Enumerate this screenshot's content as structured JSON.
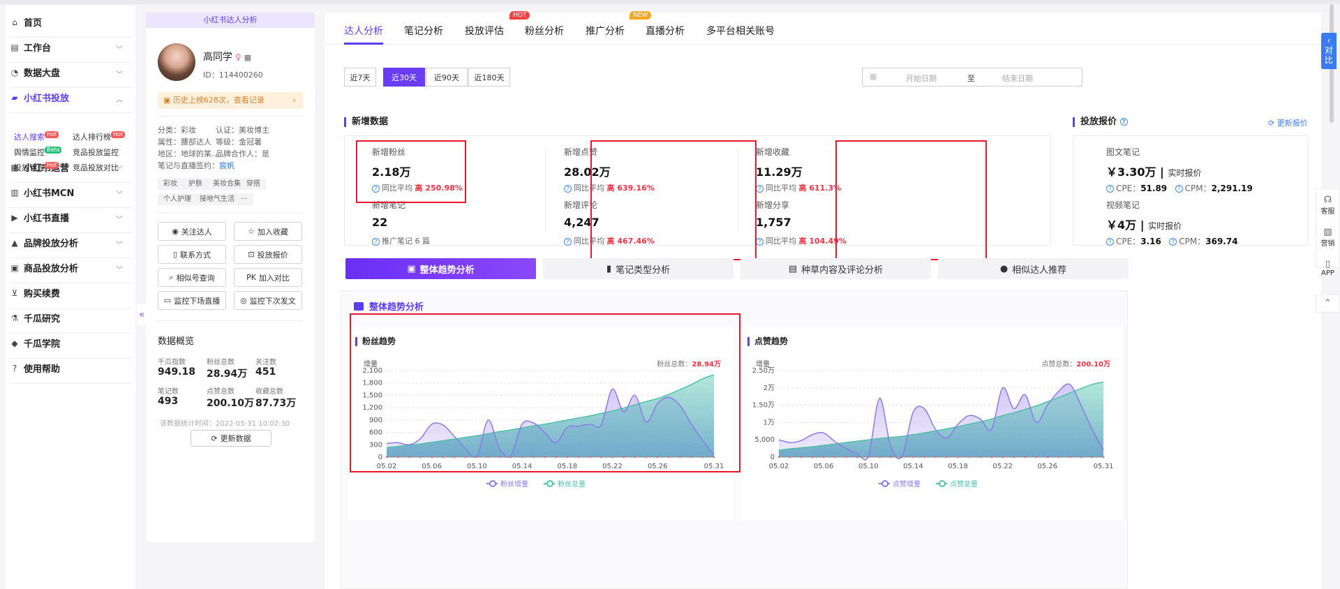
{
  "sidebar": {
    "items": [
      {
        "icon": "home-icon",
        "label": "首页",
        "chevron": false
      },
      {
        "icon": "workbench-icon",
        "label": "工作台",
        "chevron": true
      },
      {
        "icon": "dashboard-icon",
        "label": "数据大盘",
        "chevron": true
      },
      {
        "icon": "folder-icon",
        "label": "小红书投放",
        "chevron": true,
        "active": true
      },
      {
        "icon": "chart-icon",
        "label": "小红书运营",
        "chevron": true
      },
      {
        "icon": "mcn-icon",
        "label": "小红书MCN",
        "chevron": true
      },
      {
        "icon": "live-icon",
        "label": "小红书直播",
        "chevron": true
      },
      {
        "icon": "brand-icon",
        "label": "品牌投放分析",
        "chevron": true
      },
      {
        "icon": "shop-icon",
        "label": "商品投放分析",
        "chevron": true
      },
      {
        "icon": "cart-icon",
        "label": "购买续费",
        "chevron": false
      },
      {
        "icon": "flask-icon",
        "label": "千瓜研究",
        "chevron": false
      },
      {
        "icon": "graduation-icon",
        "label": "千瓜学院",
        "chevron": false
      },
      {
        "icon": "help-icon",
        "label": "使用帮助",
        "chevron": false
      }
    ],
    "subs": [
      {
        "label": "达人搜索",
        "tag": "Hot"
      },
      {
        "label": "达人排行榜",
        "tag": "Hot"
      },
      {
        "label": "舆情监控",
        "tag": "Beta"
      },
      {
        "label": "竞品投放监控",
        "tag": ""
      },
      {
        "label": "投放管理",
        "tag": "Hot"
      },
      {
        "label": "竞品投放对比",
        "tag": ""
      }
    ],
    "collapse": "«"
  },
  "profile": {
    "title": "小红书达人分析",
    "name": "高同学",
    "gender": "♀",
    "qr": "▦",
    "id": "ID：114400260",
    "history": "历史上榜628次，查看记录",
    "info": {
      "category": "分类：彩妆",
      "cert": "认证：美妆博主",
      "attr": "属性：腰部达人",
      "level": "等级：金冠薯",
      "region": "地区：地球的某...",
      "brand_partner": "品牌合作人：是",
      "sign_label": "笔记与直播签约：",
      "sign_value": "宸帆"
    },
    "chips": [
      "彩妆",
      "护肤",
      "美妆合集",
      "穿搭",
      "个人护理",
      "接地气生活",
      "···"
    ],
    "buttons": [
      {
        "icon": "eye-icon",
        "label": "关注达人"
      },
      {
        "icon": "star-icon",
        "label": "加入收藏"
      },
      {
        "icon": "phone-icon",
        "label": "联系方式"
      },
      {
        "icon": "price-icon",
        "label": "投放报价"
      },
      {
        "icon": "search-icon",
        "label": "相似号查询"
      },
      {
        "icon": "pk-icon",
        "label": "加入对比"
      },
      {
        "icon": "video-icon",
        "label": "监控下场直播"
      },
      {
        "icon": "pin-icon",
        "label": "监控下次发文"
      }
    ],
    "overview_title": "数据概览",
    "stats": [
      {
        "label": "千瓜指数",
        "value": "949.18"
      },
      {
        "label": "粉丝总数",
        "value": "28.94万"
      },
      {
        "label": "关注数",
        "value": "451"
      },
      {
        "label": "笔记数",
        "value": "493"
      },
      {
        "label": "点赞总数",
        "value": "200.10万"
      },
      {
        "label": "收藏总数",
        "value": "87.73万"
      }
    ],
    "stat_time": "该数据统计时间：2022-05-31 10:02:30",
    "refresh": "更新数据"
  },
  "tabs": [
    {
      "label": "达人分析",
      "badge": ""
    },
    {
      "label": "笔记分析",
      "badge": ""
    },
    {
      "label": "投放评估",
      "badge": ""
    },
    {
      "label": "粉丝分析",
      "badge": "HOT"
    },
    {
      "label": "推广分析",
      "badge": ""
    },
    {
      "label": "直播分析",
      "badge": "NEW"
    },
    {
      "label": "多平台相关账号",
      "badge": ""
    }
  ],
  "ranges": [
    "近7天",
    "近30天",
    "近90天",
    "近180天"
  ],
  "date": {
    "start": "开始日期",
    "sep": "至",
    "end": "结束日期"
  },
  "new_data": {
    "title": "新增数据",
    "metrics": [
      {
        "label": "新增粉丝",
        "value": "2.18万",
        "sub": "同比平均",
        "high": "高 250.98%"
      },
      {
        "label": "新增笔记",
        "value": "22",
        "sub": "推广笔记 6 篇",
        "high": ""
      },
      {
        "label": "新增点赞",
        "value": "28.02万",
        "sub": "同比平均",
        "high": "高 639.16%"
      },
      {
        "label": "新增评论",
        "value": "4,247",
        "sub": "同比平均",
        "high": "高 467.46%"
      },
      {
        "label": "新增收藏",
        "value": "11.29万",
        "sub": "同比平均",
        "high": "高 611.3%"
      },
      {
        "label": "新增分享",
        "value": "1,757",
        "sub": "同比平均",
        "high": "高 104.49%"
      }
    ]
  },
  "price": {
    "title": "投放报价",
    "update": "更新报价",
    "items": [
      {
        "label": "图文笔记",
        "value": "￥3.30万",
        "rt": "实时报价",
        "cpe_label": "CPE：",
        "cpe": "51.89",
        "cpm_label": "CPM：",
        "cpm": "2,291.19"
      },
      {
        "label": "视频笔记",
        "value": "￥4万",
        "rt": "实时报价",
        "cpe_label": "CPE：",
        "cpe": "3.16",
        "cpm_label": "CPM：",
        "cpm": "369.74"
      }
    ]
  },
  "analysis_tabs": [
    {
      "icon": "trend-icon",
      "label": "整体趋势分析"
    },
    {
      "icon": "note-icon",
      "label": "笔记类型分析"
    },
    {
      "icon": "comment-icon",
      "label": "种草内容及评论分析"
    },
    {
      "icon": "user-icon",
      "label": "相似达人推荐"
    }
  ],
  "panel_title": "整体趋势分析",
  "charts": [
    {
      "title": "粉丝趋势",
      "ylabel": "增量",
      "total_label": "粉丝总数：",
      "total_value": "28.94万",
      "legend": [
        "粉丝增量",
        "粉丝总量"
      ]
    },
    {
      "title": "点赞趋势",
      "ylabel": "增量",
      "total_label": "点赞总数：",
      "total_value": "200.10万",
      "legend": [
        "点赞增量",
        "点赞总量"
      ]
    }
  ],
  "right": {
    "compare": "对比",
    "service": "客服",
    "marketing": "营销",
    "app": "APP",
    "top": "⌃"
  },
  "colors": {
    "accent": "#5b3df5",
    "increase": "#8c7ae6",
    "total": "#4cc2a8",
    "highlight": "#e8192c"
  },
  "chart_data": [
    {
      "type": "line",
      "title": "粉丝趋势",
      "ylabel": "增量",
      "ylim": [
        0,
        2100
      ],
      "yticks": [
        "0",
        "300",
        "600",
        "900",
        "1,200",
        "1,500",
        "1,800",
        "2,100"
      ],
      "ytick_values": [
        0,
        300,
        600,
        900,
        1200,
        1500,
        1800,
        2100
      ],
      "xticks": [
        "05.02",
        "05.06",
        "05.10",
        "05.14",
        "05.18",
        "05.22",
        "05.26",
        "05.31"
      ],
      "x": [
        "05.02",
        "05.03",
        "05.04",
        "05.05",
        "05.06",
        "05.07",
        "05.08",
        "05.09",
        "05.10",
        "05.11",
        "05.12",
        "05.13",
        "05.14",
        "05.15",
        "05.16",
        "05.17",
        "05.18",
        "05.19",
        "05.20",
        "05.21",
        "05.22",
        "05.23",
        "05.24",
        "05.25",
        "05.26",
        "05.27",
        "05.28",
        "05.29",
        "05.30",
        "05.31"
      ],
      "series": [
        {
          "name": "粉丝增量",
          "values": [
            330,
            350,
            300,
            450,
            800,
            780,
            500,
            200,
            30,
            900,
            200,
            30,
            800,
            830,
            600,
            350,
            720,
            750,
            800,
            780,
            1650,
            1100,
            1500,
            850,
            1300,
            1450,
            1250,
            800,
            400,
            50
          ]
        },
        {
          "name": "粉丝总量",
          "values": [
            230,
            260,
            290,
            320,
            360,
            400,
            440,
            480,
            520,
            570,
            620,
            660,
            710,
            760,
            800,
            850,
            900,
            950,
            1000,
            1060,
            1120,
            1190,
            1270,
            1350,
            1420,
            1520,
            1640,
            1760,
            1900,
            2000
          ]
        }
      ]
    },
    {
      "type": "line",
      "title": "点赞趋势",
      "ylabel": "增量",
      "ylim": [
        0,
        25000
      ],
      "yticks": [
        "0",
        "5,000",
        "1万",
        "1.50万",
        "2万",
        "2.50万"
      ],
      "ytick_values": [
        0,
        5000,
        10000,
        15000,
        20000,
        25000
      ],
      "xticks": [
        "05.02",
        "05.06",
        "05.10",
        "05.14",
        "05.18",
        "05.22",
        "05.26",
        "05.31"
      ],
      "x": [
        "05.02",
        "05.03",
        "05.04",
        "05.05",
        "05.06",
        "05.07",
        "05.08",
        "05.09",
        "05.10",
        "05.11",
        "05.12",
        "05.13",
        "05.14",
        "05.15",
        "05.16",
        "05.17",
        "05.18",
        "05.19",
        "05.20",
        "05.21",
        "05.22",
        "05.23",
        "05.24",
        "05.25",
        "05.26",
        "05.27",
        "05.28",
        "05.29",
        "05.30",
        "05.31"
      ],
      "series": [
        {
          "name": "点赞增量",
          "values": [
            5000,
            4200,
            4800,
            6500,
            7000,
            4500,
            2500,
            1000,
            300,
            17000,
            3000,
            200,
            13000,
            14000,
            8000,
            5500,
            9500,
            12000,
            11000,
            8000,
            20000,
            14000,
            18000,
            10000,
            15000,
            19000,
            21000,
            15000,
            8000,
            2000
          ]
        },
        {
          "name": "点赞总量",
          "values": [
            2000,
            2400,
            2700,
            3000,
            3400,
            3800,
            4200,
            4600,
            5000,
            5400,
            5700,
            6000,
            6500,
            7000,
            7600,
            8200,
            8800,
            9500,
            10200,
            11000,
            12000,
            12800,
            13800,
            14800,
            16000,
            17200,
            18500,
            19800,
            21000,
            21700
          ]
        }
      ]
    }
  ]
}
